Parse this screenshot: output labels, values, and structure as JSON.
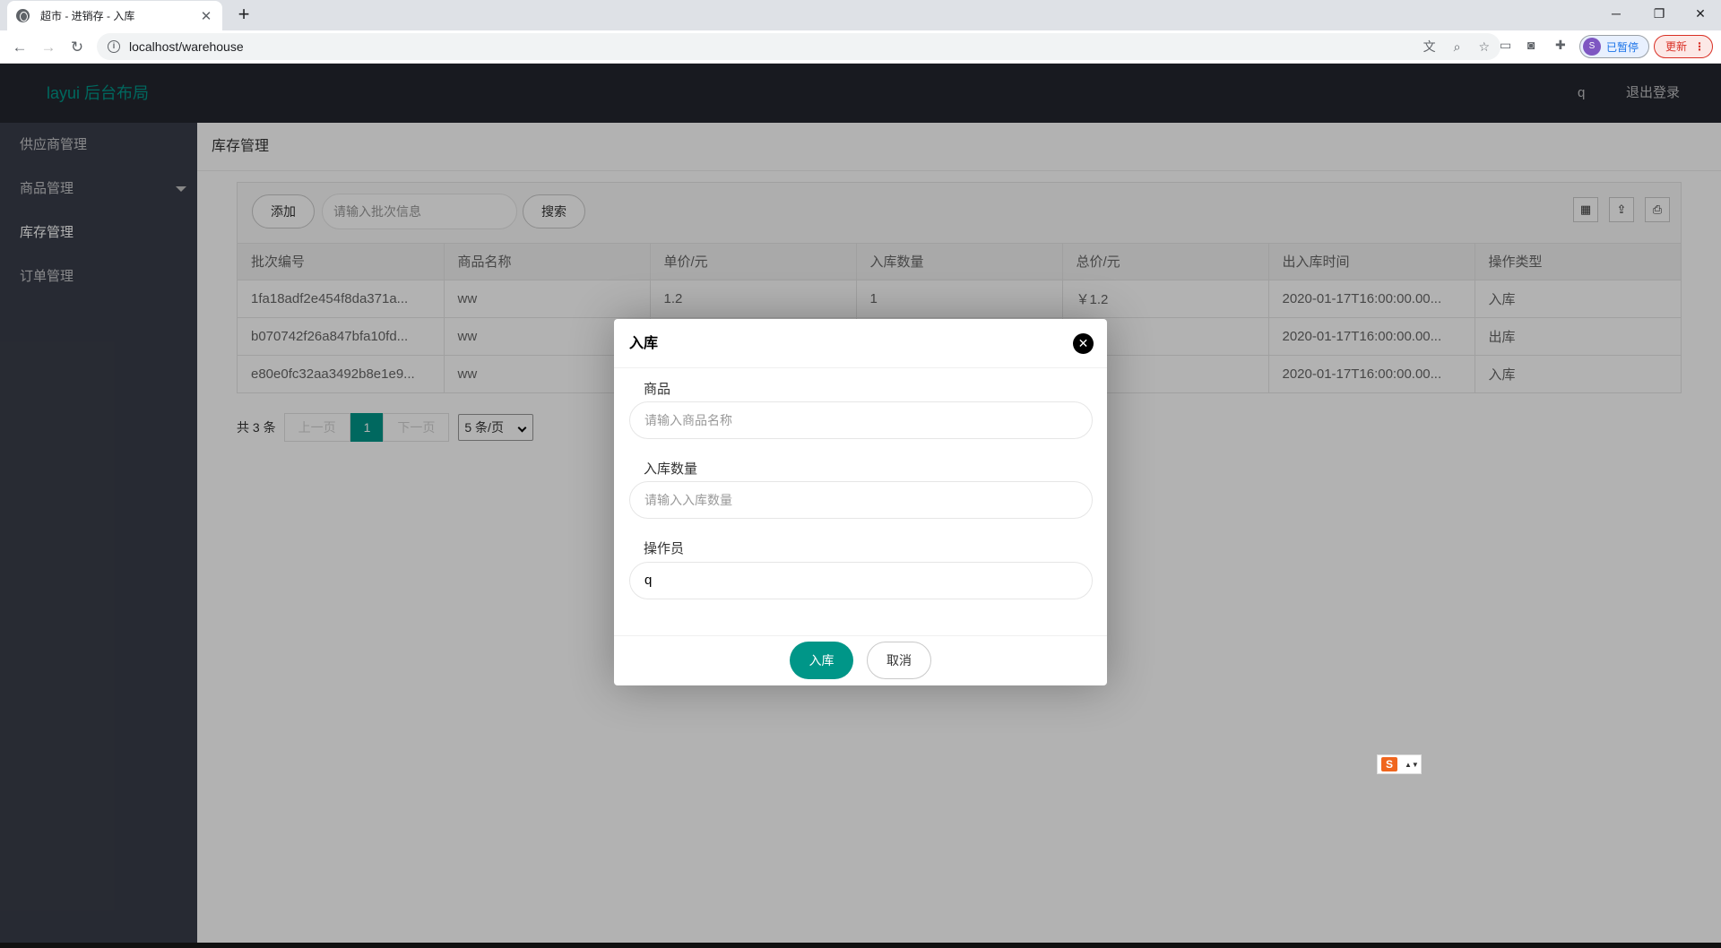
{
  "browser": {
    "tab_title": "超市 - 进销存 - 入库",
    "tab_close": "✕",
    "new_tab": "+",
    "win_min": "─",
    "win_restore": "❐",
    "win_close": "✕",
    "back": "←",
    "forward": "→",
    "reload": "↻",
    "info": "i",
    "url": "localhost/warehouse",
    "profile_initial": "S",
    "profile_status": "已暂停",
    "update_label": "更新",
    "update_more": "⋮"
  },
  "header": {
    "logo": "layui 后台布局",
    "user": "q",
    "logout": "退出登录"
  },
  "sidebar": {
    "items": [
      {
        "label": "供应商管理"
      },
      {
        "label": "商品管理"
      },
      {
        "label": "库存管理"
      },
      {
        "label": "订单管理"
      }
    ]
  },
  "main": {
    "breadcrumb": "库存管理",
    "toolbar": {
      "add_label": "添加",
      "search_placeholder": "请输入批次信息",
      "search_label": "搜索"
    },
    "table": {
      "columns": [
        "批次编号",
        "商品名称",
        "单价/元",
        "入库数量",
        "总价/元",
        "出入库时间",
        "操作类型"
      ],
      "rows": [
        [
          "1fa18adf2e454f8da371a...",
          "ww",
          "1.2",
          "1",
          "￥1.2",
          "2020-01-17T16:00:00.00...",
          "入库"
        ],
        [
          "b070742f26a847bfa10fd...",
          "ww",
          "",
          "",
          "",
          "2020-01-17T16:00:00.00...",
          "出库"
        ],
        [
          "e80e0fc32aa3492b8e1e9...",
          "ww",
          "",
          "",
          "",
          "2020-01-17T16:00:00.00...",
          "入库"
        ]
      ]
    },
    "pager": {
      "count": "共 3 条",
      "prev": "上一页",
      "current": "1",
      "next": "下一页",
      "page_size": "5 条/页"
    }
  },
  "modal": {
    "title": "入库",
    "close": "✕",
    "fields": {
      "product_label": "商品",
      "product_placeholder": "请输入商品名称",
      "qty_label": "入库数量",
      "qty_placeholder": "请输入入库数量",
      "operator_label": "操作员",
      "operator_value": "q"
    },
    "submit_label": "入库",
    "cancel_label": "取消"
  },
  "ime": {
    "logo": "S",
    "arrows": "▲▼"
  },
  "colors": {
    "accent": "#009688",
    "header_bg": "#23262e",
    "sidebar_bg": "#393d49"
  }
}
